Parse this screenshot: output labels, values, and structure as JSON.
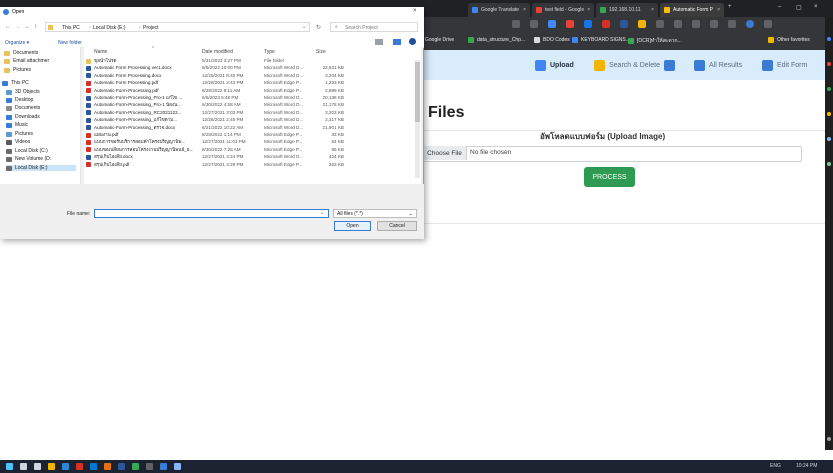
{
  "browser": {
    "tabs": [
      {
        "label": "Google Translate",
        "color": "#4285f4"
      },
      {
        "label": "test field - Google",
        "color": "#ea4335"
      },
      {
        "label": "192.168.10.11",
        "color": "#34a853"
      },
      {
        "label": "Automatic Form P",
        "color": "#fbbc05"
      }
    ],
    "bookmarks": [
      {
        "label": "Google Drive",
        "color": "#fbbc05"
      },
      {
        "label": "data_structure_Chp...",
        "color": "#34a853"
      },
      {
        "label": "BDO Codes",
        "color": "#dadce0"
      },
      {
        "label": "KEYBOARD SIGNS...",
        "color": "#4285f4"
      },
      {
        "label": "[OCR]ทำให้สะดวก...",
        "color": "#34a853"
      },
      {
        "label": "Other favorites",
        "color": "#f4b400"
      }
    ]
  },
  "nav": {
    "items": [
      {
        "label": "Upload",
        "color": "#4285f4"
      },
      {
        "label": "Search & Delete",
        "color": "#f4b400"
      },
      {
        "label": "All Results",
        "color": "#3a7bd5"
      },
      {
        "label": "Edit Form",
        "color": "#3a7bd5"
      }
    ]
  },
  "main": {
    "title": "Files",
    "upload_heading": "อัพโหลดแบบฟอร์ม (Upload Image)",
    "choose_file": "Choose File",
    "no_file": "No file chosen",
    "process": "PROCESS"
  },
  "dialog": {
    "title": "Open",
    "breadcrumb": [
      "This PC",
      "Local Disk (E:)",
      "Project"
    ],
    "search_placeholder": "Search Project",
    "organize": "Organize ▾",
    "new_folder": "New folder",
    "nav_items": [
      {
        "label": "Documents",
        "color": "#e8c35a"
      },
      {
        "label": "Email attachmer",
        "color": "#e8c35a"
      },
      {
        "label": "Pictures",
        "color": "#e8c35a"
      },
      {
        "label": "This PC",
        "color": "#3a7bd5"
      },
      {
        "label": "3D Objects",
        "color": "#5b9bd5"
      },
      {
        "label": "Desktop",
        "color": "#3a7bd5"
      },
      {
        "label": "Documents",
        "color": "#8a8a8a"
      },
      {
        "label": "Downloads",
        "color": "#3a7bd5"
      },
      {
        "label": "Music",
        "color": "#3a7bd5"
      },
      {
        "label": "Pictures",
        "color": "#5b9bd5"
      },
      {
        "label": "Videos",
        "color": "#5b5b5b"
      },
      {
        "label": "Local Disk (C:)",
        "color": "#6b6b6b"
      },
      {
        "label": "New Volume (D:",
        "color": "#6b6b6b"
      },
      {
        "label": "Local Disk (E:)",
        "color": "#6b6b6b"
      }
    ],
    "columns": {
      "name": "Name",
      "date": "Date modified",
      "type": "Type",
      "size": "Size"
    },
    "files": [
      {
        "name": "ขุลน้ำโปรด",
        "date": "5/31/2023 3:27 PM",
        "type": "File folder",
        "size": "",
        "color": "#e8c35a"
      },
      {
        "name": "Automatic Form Processing ver1.docx",
        "date": "6/5/2022 10:00 PM",
        "type": "Microsoft Word D...",
        "size": "22,931 KB",
        "color": "#2b579a"
      },
      {
        "name": "Automatic Form Processing.docx",
        "date": "12/25/2021 8:45 PM",
        "type": "Microsoft Word D...",
        "size": "3,204 KB",
        "color": "#2b579a"
      },
      {
        "name": "Automatic Form Processing.pdf",
        "date": "12/28/2021 2:43 PM",
        "type": "Microsoft Edge P...",
        "size": "1,253 KB",
        "color": "#d93025"
      },
      {
        "name": "Automatic-Form-Processing.pdf",
        "date": "8/28/2022 8:11 AM",
        "type": "Microsoft Edge P...",
        "size": "2,889 KB",
        "color": "#d93025"
      },
      {
        "name": "Automatic-Form-Processing_Pro-1 แก้ไข ...",
        "date": "6/5/2023 5:48 PM",
        "type": "Microsoft Word D...",
        "size": "20,138 KB",
        "color": "#2b579a"
      },
      {
        "name": "Automatic-Form-Processing_Pro-1 น้องน...",
        "date": "6/30/2022 4:58 AM",
        "type": "Microsoft Word D...",
        "size": "21,178 KB",
        "color": "#2b579a"
      },
      {
        "name": "Automatic-Form-Processing_RC2021122...",
        "date": "12/27/2021 3:03 PM",
        "type": "Microsoft Word D...",
        "size": "3,203 KB",
        "color": "#2b579a"
      },
      {
        "name": "Automatic-Form-Processing_แก้ไขตาม...",
        "date": "12/28/2021 2:45 PM",
        "type": "Microsoft Word D...",
        "size": "2,317 KB",
        "color": "#2b579a"
      },
      {
        "name": "Automatic-Form-Processing_ตรวจ.docx",
        "date": "6/21/2022 10:22 AM",
        "type": "Microsoft Word D...",
        "size": "21,901 KB",
        "color": "#2b579a"
      },
      {
        "name": "แผนงาน.pdf",
        "date": "8/28/2022 1:14 PM",
        "type": "Microsoft Edge P...",
        "size": "33 KB",
        "color": "#d93025"
      },
      {
        "name": "แบบการขอรับบริการสอบค้าโครงปริญญานิพ...",
        "date": "12/27/2021 11:03 PM",
        "type": "Microsoft Edge P...",
        "size": "64 KB",
        "color": "#d93025"
      },
      {
        "name": "แบบขอเปลี่ยนการสอบโครงงานปริญญานิพนธ์_อ...",
        "date": "8/30/2022 7:28 AM",
        "type": "Microsoft Edge P...",
        "size": "95 KB",
        "color": "#d93025"
      },
      {
        "name": "สรุปเก็บไอเดีย.docx",
        "date": "12/27/2021 3:24 PM",
        "type": "Microsoft Word D...",
        "size": "424 KB",
        "color": "#2b579a"
      },
      {
        "name": "สรุปเก็บไอเดีย.pdf",
        "date": "12/27/2021 3:29 PM",
        "type": "Microsoft Edge P...",
        "size": "263 KB",
        "color": "#d93025"
      }
    ],
    "filename_label": "File name:",
    "filter": "All files (*.*)",
    "open": "Open",
    "cancel": "Cancel"
  },
  "taskbar": {
    "clock": "10:24 PM",
    "lang": "ENG"
  }
}
